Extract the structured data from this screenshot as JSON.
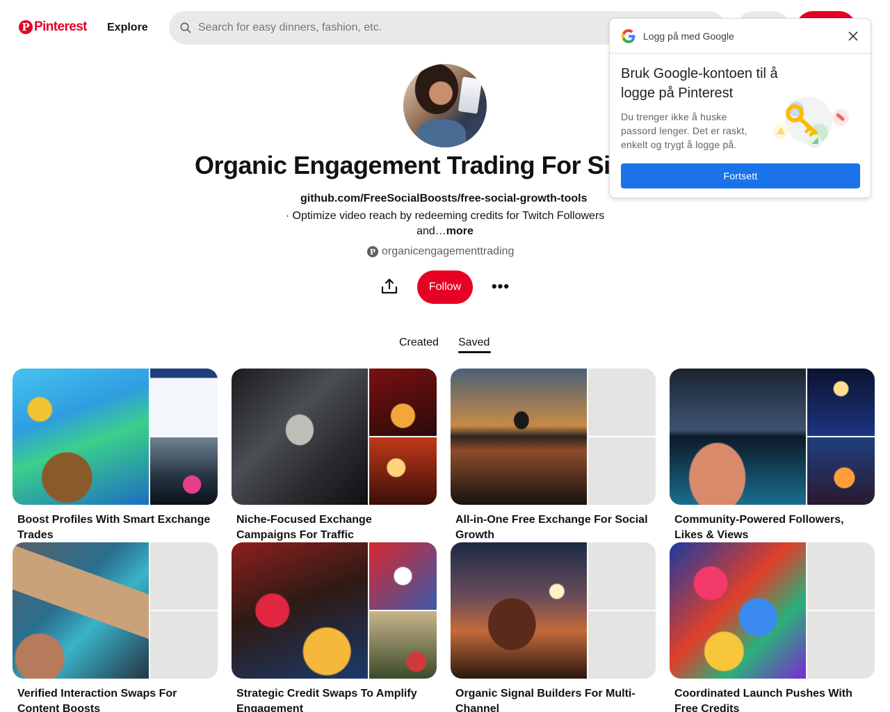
{
  "header": {
    "logo_text": "Pinterest",
    "explore_label": "Explore",
    "search_placeholder": "Search for easy dinners, fashion, etc."
  },
  "profile": {
    "title": "Organic Engagement Trading For Site",
    "link": "github.com/FreeSocialBoosts/free-social-growth-tools",
    "about_line1": "· Optimize video reach by redeeming credits for Twitch Followers",
    "about_line2": "and…",
    "more_label": "more",
    "username": "organicengagementtrading",
    "follow_label": "Follow"
  },
  "tabs": {
    "created": "Created",
    "saved": "Saved",
    "active": "Saved"
  },
  "boards": [
    {
      "title": "Boost Profiles With Smart Exchange Trades"
    },
    {
      "title": "Niche-Focused Exchange Campaigns For Traffic"
    },
    {
      "title": "All-in-One Free Exchange For Social Growth"
    },
    {
      "title": "Community-Powered Followers, Likes & Views"
    },
    {
      "title": "Verified Interaction Swaps For Content Boosts"
    },
    {
      "title": "Strategic Credit Swaps To Amplify Engagement"
    },
    {
      "title": "Organic Signal Builders For Multi-Channel"
    },
    {
      "title": "Coordinated Launch Pushes With Free Credits"
    }
  ],
  "google_popup": {
    "header_title": "Logg på med Google",
    "heading": "Bruk Google-kontoen til å logge på Pinterest",
    "body": "Du trenger ikke å huske passord lenger. Det er raskt, enkelt og trygt å logge på.",
    "button_label": "Fortsett"
  },
  "colors": {
    "brand": "#e60023",
    "google_blue": "#1a73e8",
    "empty_tile": "#e4e4e2"
  }
}
